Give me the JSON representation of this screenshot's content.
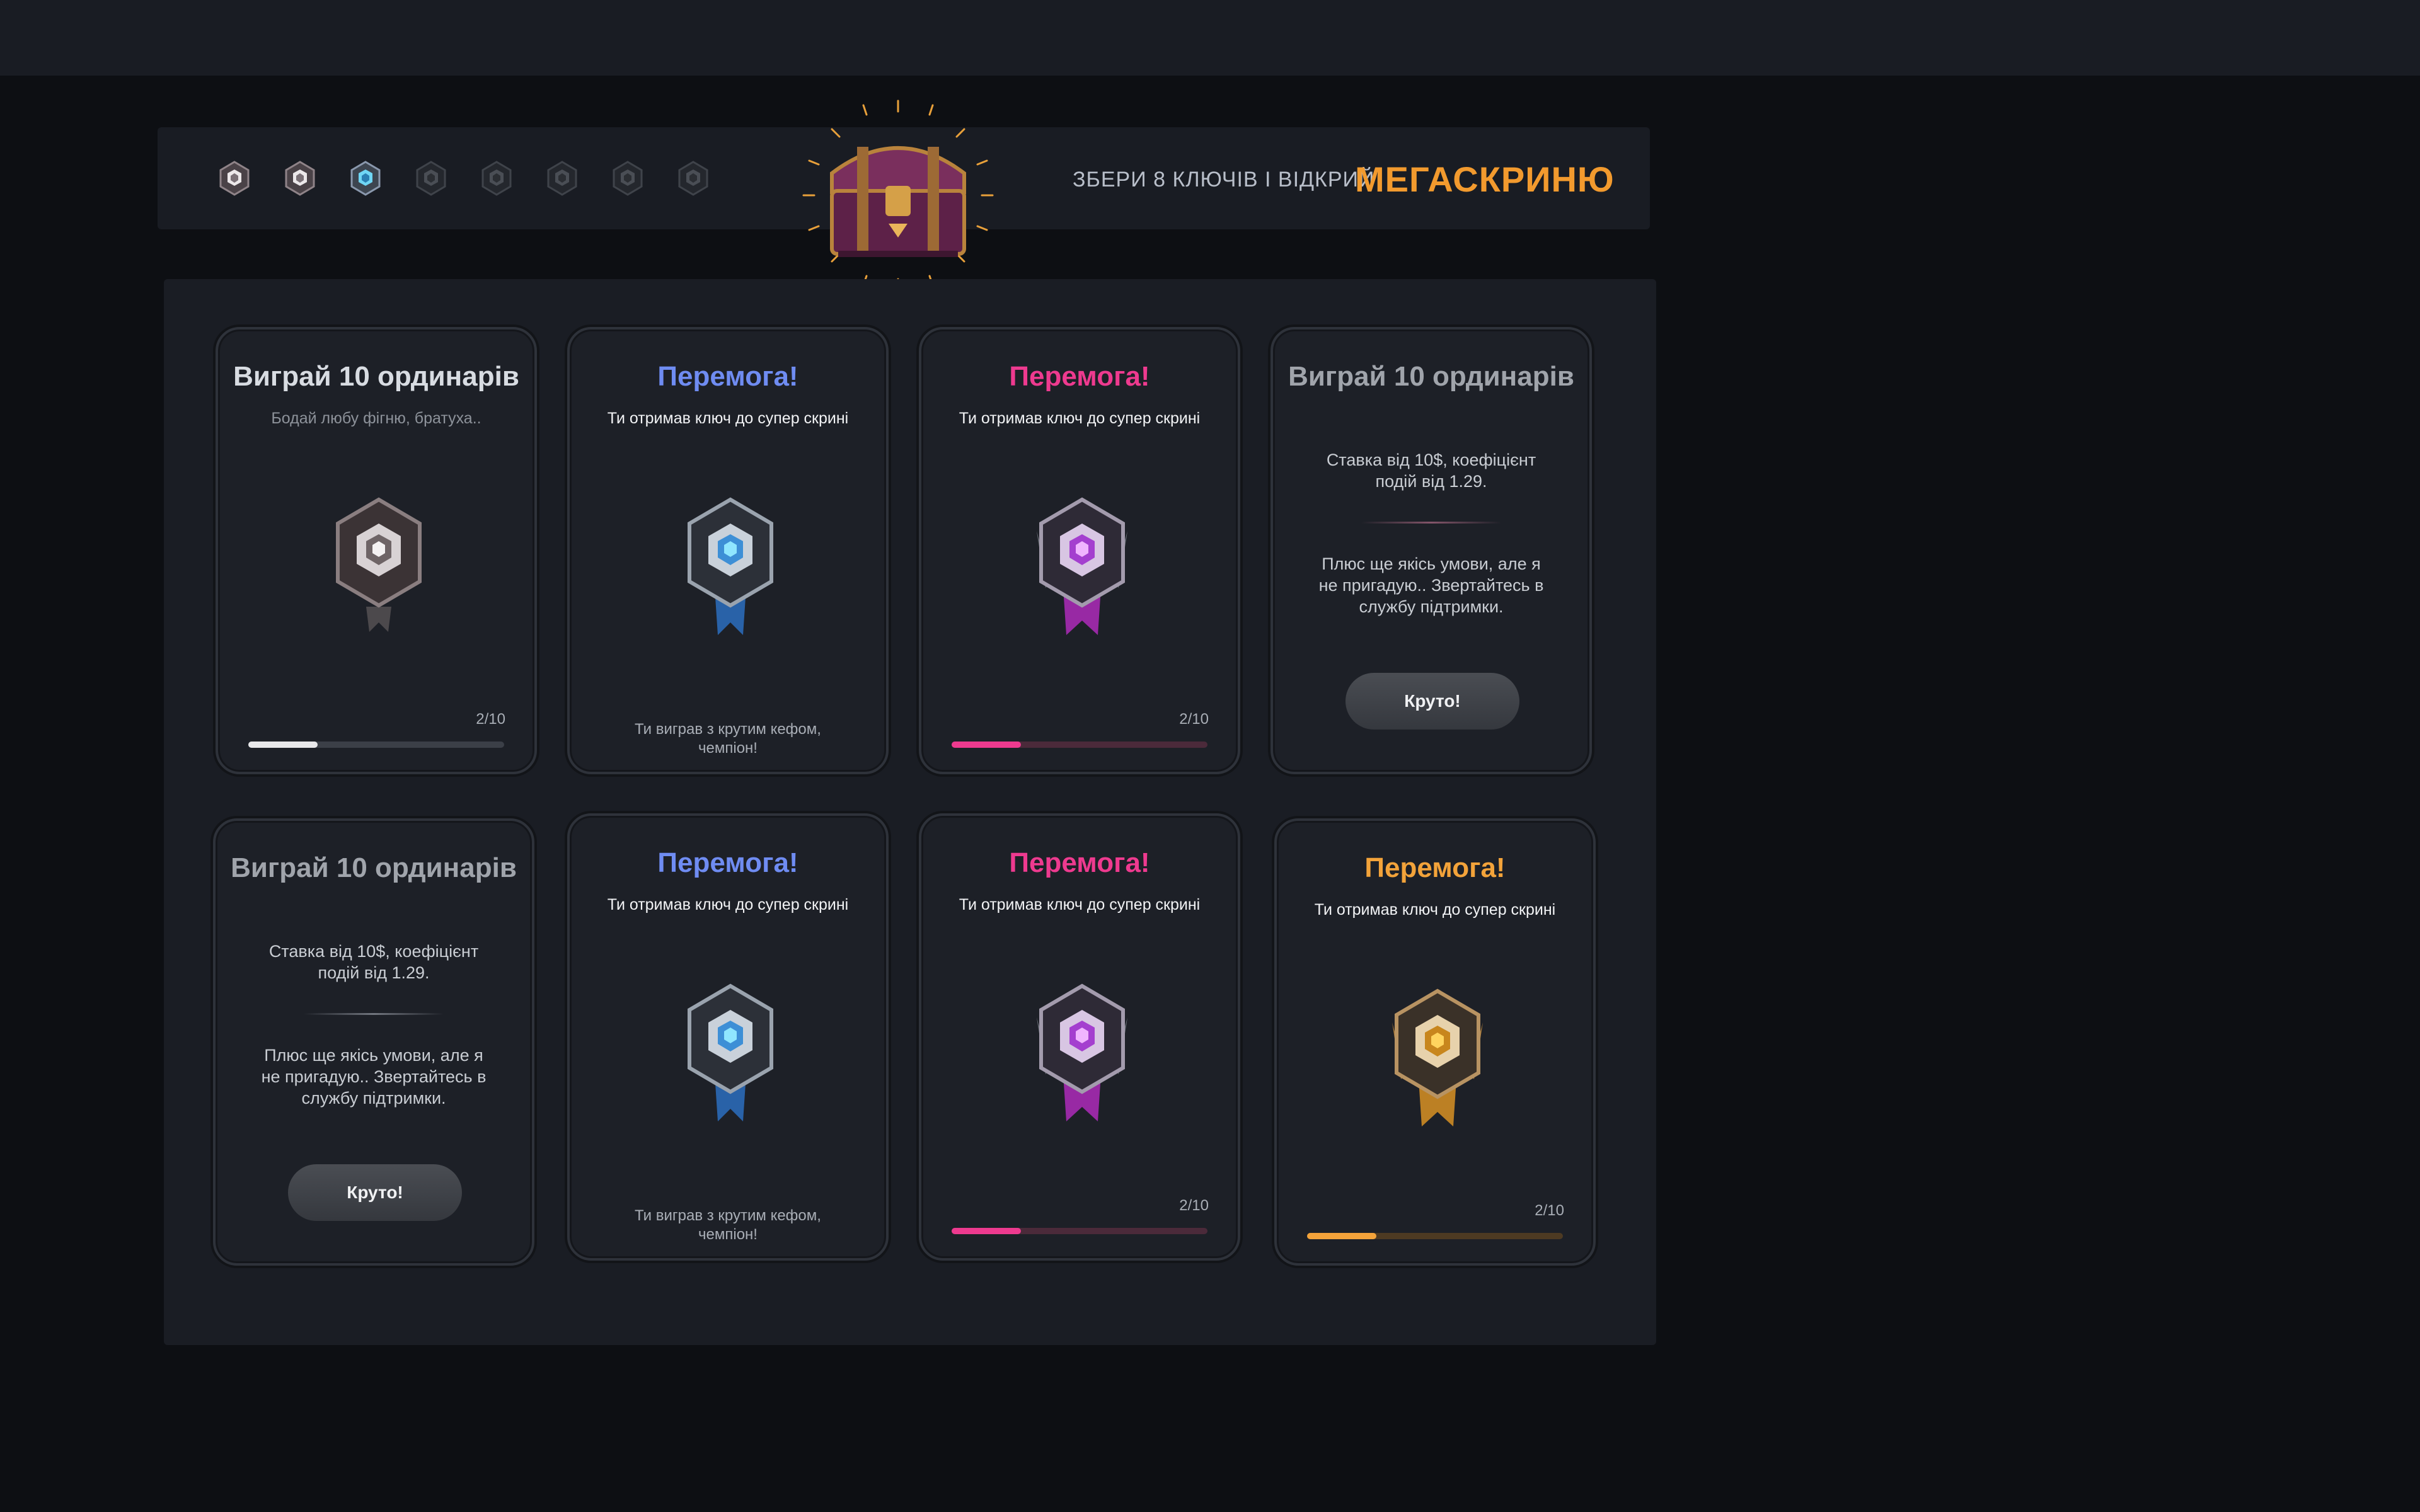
{
  "header": {
    "prompt": "ЗБЕРИ 8 КЛЮЧІВ І ВІДКРИЙ",
    "title": "МЕГАСКРИНЮ",
    "keys": [
      {
        "tier": "silver",
        "collected": true
      },
      {
        "tier": "silver",
        "collected": true
      },
      {
        "tier": "blue",
        "collected": true
      },
      {
        "tier": "dark",
        "collected": false
      },
      {
        "tier": "dark",
        "collected": false
      },
      {
        "tier": "dark",
        "collected": false
      },
      {
        "tier": "dark",
        "collected": false
      },
      {
        "tier": "dark",
        "collected": false
      }
    ],
    "chest_icon": "treasure-chest-icon"
  },
  "cards": [
    {
      "title": "Виграй 10 ординарів",
      "subtitle": "Бодай любу фігню, братуха..",
      "emblem": "silver-key-emblem",
      "progress_text": "2/10",
      "progress": 0.27,
      "bar_color": "#e8e8ea"
    },
    {
      "title": "Перемога!",
      "subtitle": "Ти отримав ключ до супер скрині",
      "emblem": "blue-key-emblem",
      "footer": "Ти виграв з крутим кефом, чемпіон!"
    },
    {
      "title": "Перемога!",
      "subtitle": "Ти отримав ключ до супер скрині",
      "emblem": "pink-key-emblem",
      "progress_text": "2/10",
      "progress": 0.27,
      "bar_color": "#ee3a8f"
    },
    {
      "title": "Виграй 10 ординарів",
      "info1": "Ставка від 10$, коефіцієнт подій  від 1.29.",
      "info2": "Плюс ще якісь умови, але я не пригадую.. Звертайтесь в службу підтримки.",
      "button": "Круто!"
    },
    {
      "title": "Виграй 10 ординарів",
      "info1": "Ставка від 10$, коефіцієнт подій  від 1.29.",
      "info2": "Плюс ще якісь умови, але я не пригадую.. Звертайтесь в службу підтримки.",
      "button": "Круто!"
    },
    {
      "title": "Перемога!",
      "subtitle": "Ти отримав ключ до супер скрині",
      "emblem": "blue-key-emblem",
      "footer": "Ти виграв з крутим кефом, чемпіон!"
    },
    {
      "title": "Перемога!",
      "subtitle": "Ти отримав ключ до супер скрині",
      "emblem": "pink-key-emblem",
      "progress_text": "2/10",
      "progress": 0.27,
      "bar_color": "#ee3a8f"
    },
    {
      "title": "Перемога!",
      "subtitle": "Ти отримав ключ до супер скрині",
      "emblem": "gold-key-emblem",
      "progress_text": "2/10",
      "progress": 0.27,
      "bar_color": "#f3a33a"
    }
  ]
}
